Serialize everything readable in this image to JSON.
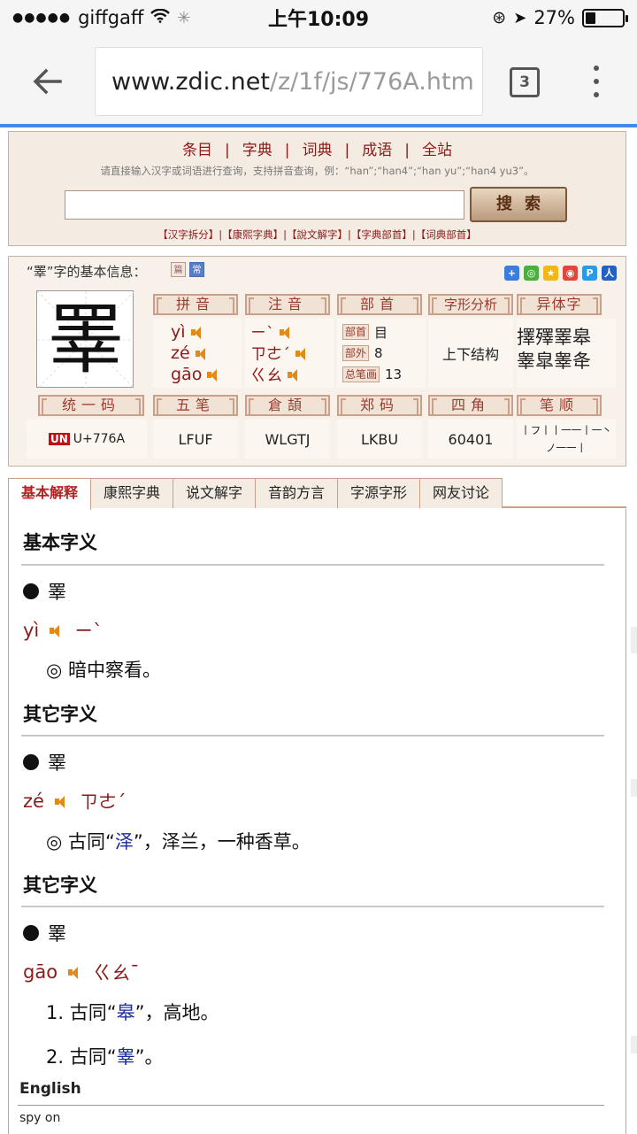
{
  "status": {
    "carrier": "giffgaff",
    "time": "上午10:09",
    "battery_text": "27%",
    "battery_level": 0.27
  },
  "browser": {
    "url_domain": "www.zdic.net",
    "url_path": "/z/1f/js/776A.htm",
    "tab_count": "3"
  },
  "site_nav": {
    "items": [
      "条目",
      "字典",
      "词典",
      "成语",
      "全站"
    ],
    "separator": "|",
    "hint": "请直接输入汉字或词语进行查询，支持拼音查询，例：“han”;“han4”;“han yu”;“han4 yu3”。",
    "search_placeholder": "",
    "search_button": "搜索",
    "sublinks": "【汉字拆分】|【康熙字典】|【說文解字】|【字典部首】|【词典部首】"
  },
  "info": {
    "title": "“睪”字的基本信息：",
    "badges": [
      "篇",
      "常"
    ],
    "char": "睪",
    "labels": {
      "pinyin": "拼音",
      "zhuyin": "注音",
      "bushou": "部首",
      "zixing": "字形分析",
      "yiti": "异体字",
      "tongyi": "统一码",
      "wubi": "五笔",
      "cangjie": "倉頡",
      "zhengma": "郑码",
      "sijiao": "四角",
      "bishun": "笔顺"
    },
    "pinyin": [
      "yì",
      "zé",
      "gāo"
    ],
    "zhuyin": [
      "ㄧˋ",
      "ㄗㄜˊ",
      "ㄍㄠ"
    ],
    "bushou_tags": [
      "部首",
      "部外",
      "总笔画"
    ],
    "bushou_vals": [
      "目",
      "8",
      "13"
    ],
    "structure": "上下结构",
    "variants_line1": "擇殬睪皋",
    "variants_line2": "睾皐睾夅",
    "unicode": "U+776A",
    "unicode_logo": "UN",
    "wubi": "LFUF",
    "cangjie": "WLGTJ",
    "zhengma": "LKBU",
    "sijiao": "60401",
    "bishun_line1": "丨フ丨丨一一丨一丶",
    "bishun_line2": "ノ一一丨"
  },
  "tabs": [
    "基本解释",
    "康熙字典",
    "说文解字",
    "音韵方言",
    "字源字形",
    "网友讨论"
  ],
  "content": {
    "section1": "基本字义",
    "entry1_char": "睪",
    "entry1_pinyin": "yì",
    "entry1_zhuyin": "ㄧˋ",
    "entry1_def": "◎ 暗中察看。",
    "section2": "其它字义",
    "entry2_char": "睪",
    "entry2_pinyin": "zé",
    "entry2_zhuyin": "ㄗㄜˊ",
    "entry2_def_pre": "◎ 古同“",
    "entry2_def_link": "泽",
    "entry2_def_post": "”，泽兰，一种香草。",
    "section3": "其它字义",
    "entry3_char": "睪",
    "entry3_pinyin": "gāo",
    "entry3_zhuyin": "ㄍㄠˉ",
    "entry3_def1_pre": "1. 古同“",
    "entry3_def1_link": "皋",
    "entry3_def1_post": "”，高地。",
    "entry3_def2_pre": "2. 古同“",
    "entry3_def2_link": "睾",
    "entry3_def2_post": "”。",
    "english_heading": "English",
    "english_text": "spy on"
  }
}
